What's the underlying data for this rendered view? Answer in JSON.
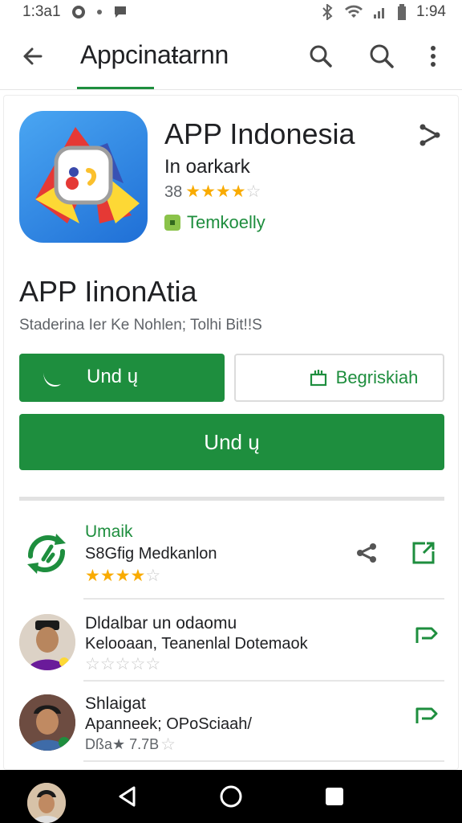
{
  "status_bar": {
    "time_left": "1:3a1",
    "time_right": "1:94"
  },
  "app_bar": {
    "title": "Appcinaŧarnn"
  },
  "hero": {
    "title": "APP Indonesia",
    "subtitle": "In oarkark",
    "rating_count": "38",
    "rating_stars": 4,
    "tag": "Temkoelly"
  },
  "main": {
    "title": "APP IinonAtia",
    "subtitle": "Staderina Ier Ke Nohlen; Tolhi Bit!!S"
  },
  "buttons": {
    "install_small": "Und ų",
    "secondary": "Begriskiah",
    "install_wide": "Und ų"
  },
  "list": [
    {
      "title": "Umaik",
      "subtitle": "S8Gfig Medkanlon",
      "rating_stars": 4,
      "rating_text": ""
    },
    {
      "title": "Dldalbar un odaomu",
      "subtitle": "Kelooaan, Teanenlal Dotemaok",
      "rating_stars": 0,
      "rating_text": ""
    },
    {
      "title": "Shlaigat",
      "subtitle": "Apanneek; OPoSciaah/",
      "rating_stars": 0,
      "rating_text": "Dßa★ 7.7B"
    }
  ],
  "colors": {
    "accent": "#1e8e3e",
    "star": "#f9ab00",
    "icon_bg": "#1f6fd6"
  },
  "icons": [
    "back-arrow-icon",
    "search-icon",
    "more-vert-icon",
    "share-icon",
    "install-moon-icon",
    "bag-icon",
    "open-external-icon",
    "send-icon",
    "back-triangle-icon",
    "home-circle-icon",
    "recents-square-icon"
  ]
}
